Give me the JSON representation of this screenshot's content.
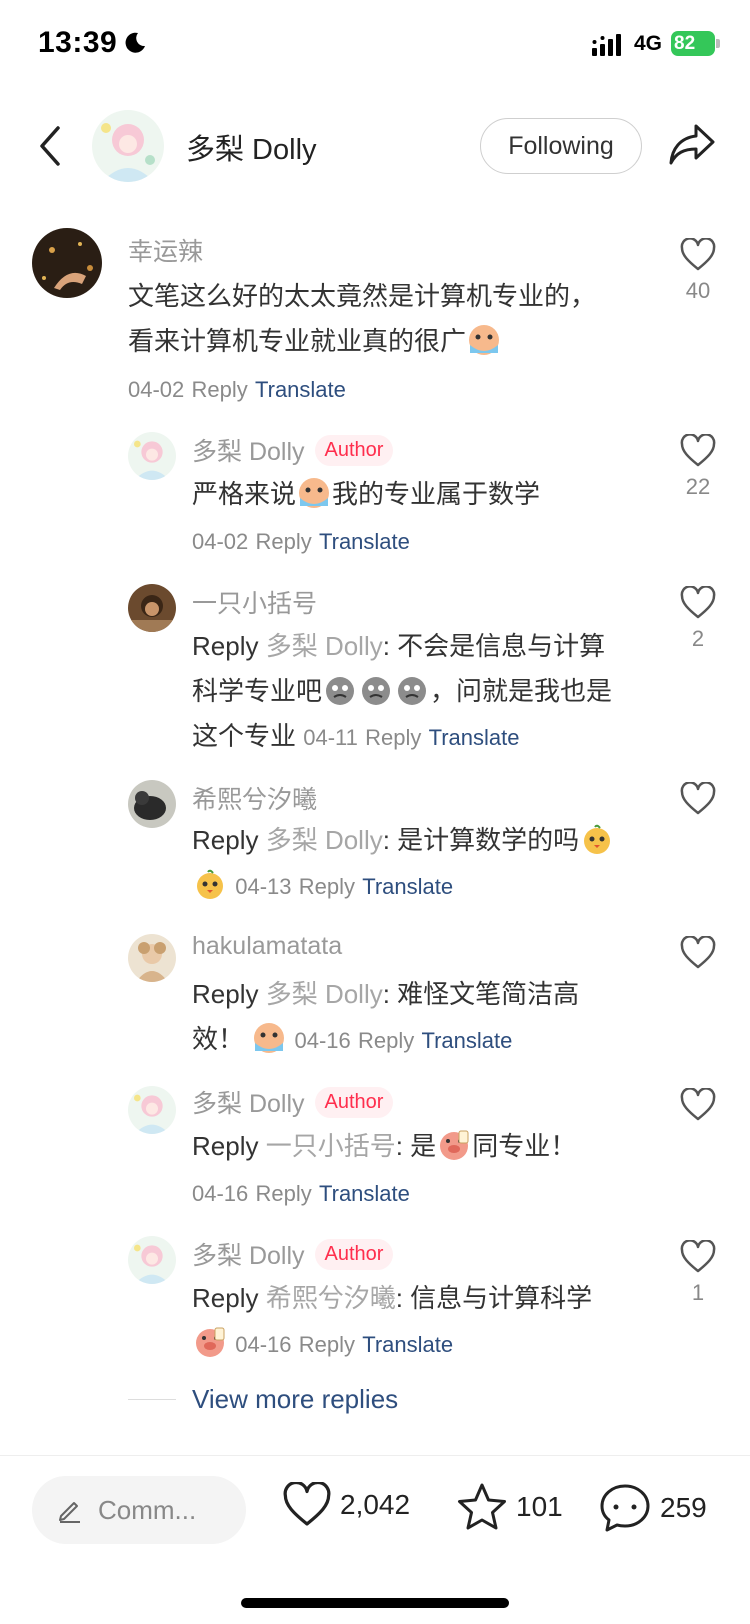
{
  "status_bar": {
    "time": "13:39",
    "network": "4G",
    "battery": "82"
  },
  "header": {
    "name": "多梨 Dolly",
    "follow_label": "Following"
  },
  "comments": [
    {
      "name": "幸运辣",
      "text_line1": "文笔这么好的太太竟然是计算机专业的，",
      "text_line2": "看来计算机专业就业真的很广",
      "date": "04-02",
      "reply": "Reply",
      "translate": "Translate",
      "likes": "40"
    }
  ],
  "replies": [
    {
      "name": "多梨 Dolly",
      "badge": "Author",
      "text_a": "严格来说",
      "text_b": "我的专业属于数学",
      "date": "04-02",
      "reply": "Reply",
      "translate": "Translate",
      "likes": "22"
    },
    {
      "name": "一只小括号",
      "reply_prefix": "Reply",
      "reply_to": "多梨 Dolly",
      "text_line1": ": 不会是信息与计算",
      "text_line2a": "科学专业吧",
      "text_line2b": "，问就是我也是",
      "text_line3": "这个专业",
      "date": "04-11",
      "reply": "Reply",
      "translate": "Translate",
      "likes": "2"
    },
    {
      "name": "希熙兮汐曦",
      "reply_prefix": "Reply",
      "reply_to": "多梨 Dolly",
      "text": ": 是计算数学的吗",
      "date": "04-13",
      "reply": "Reply",
      "translate": "Translate"
    },
    {
      "name": "hakulamatata",
      "reply_prefix": "Reply",
      "reply_to": "多梨 Dolly",
      "text_line1": ": 难怪文笔简洁高",
      "text_line2": "效！",
      "date": "04-16",
      "reply": "Reply",
      "translate": "Translate"
    },
    {
      "name": "多梨 Dolly",
      "badge": "Author",
      "reply_prefix": "Reply",
      "reply_to": "一只小括号",
      "text_a": ": 是",
      "text_b": "同专业！",
      "date": "04-16",
      "reply": "Reply",
      "translate": "Translate"
    },
    {
      "name": "多梨 Dolly",
      "badge": "Author",
      "reply_prefix": "Reply",
      "reply_to": "希熙兮汐曦",
      "text": ": 信息与计算科学",
      "date": "04-16",
      "reply": "Reply",
      "translate": "Translate",
      "likes": "1"
    }
  ],
  "view_more": "View more replies",
  "bottom_bar": {
    "comment_placeholder": "Comm...",
    "likes": "2,042",
    "stars": "101",
    "comments": "259"
  },
  "colors": {
    "accent_link": "#2e4e7e",
    "author_badge": "#ff2e4d",
    "battery": "#34c759"
  },
  "icons": [
    "moon-icon",
    "signal-icon",
    "back-icon",
    "share-icon",
    "heart-icon",
    "star-icon",
    "chat-icon",
    "pen-icon"
  ]
}
